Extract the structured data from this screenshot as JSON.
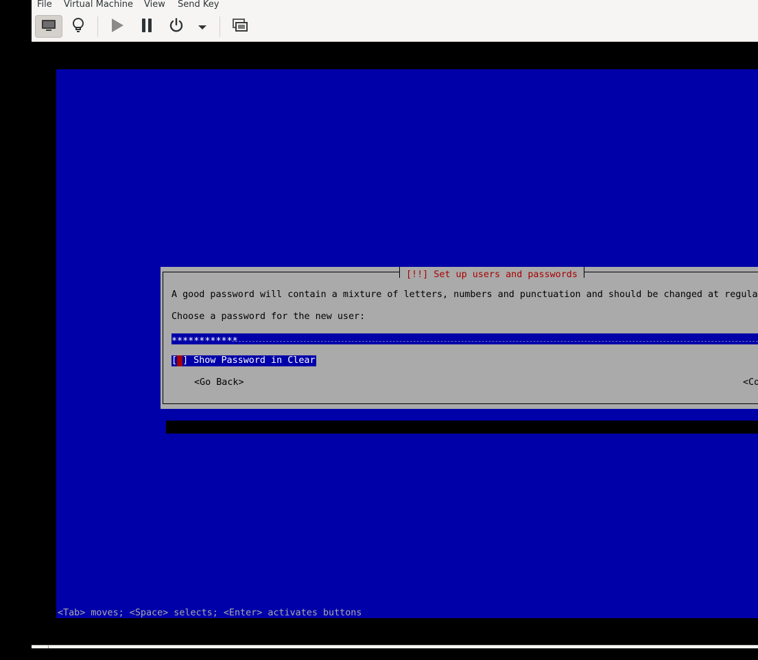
{
  "menubar": {
    "items": [
      "File",
      "Virtual Machine",
      "View",
      "Send Key"
    ]
  },
  "toolbar": {
    "buttons": [
      {
        "icon": "monitor-icon",
        "active": true
      },
      {
        "icon": "lightbulb-icon",
        "active": false
      },
      {
        "icon": "play-icon",
        "active": false
      },
      {
        "icon": "pause-icon",
        "active": false
      },
      {
        "icon": "power-icon",
        "active": false
      },
      {
        "icon": "chevron-down-icon",
        "active": false
      },
      {
        "icon": "screens-icon",
        "active": false
      }
    ]
  },
  "installer": {
    "title": "[!!] Set up users and passwords",
    "description": "A good password will contain a mixture of letters, numbers and punctuation and should be changed at regular",
    "prompt": "Choose a password for the new user:",
    "password_value": "************",
    "show_password_prefix": "[",
    "show_password_suffix": "] Show Password in Clear",
    "go_back_label": "<Go Back>",
    "continue_label": "<Co",
    "help_line": "<Tab> moves; <Space> selects; <Enter> activates buttons"
  },
  "colors": {
    "screen_bg": "#0000a8",
    "dialog_bg": "#aaaaaa",
    "title_color": "#a80000",
    "toolbar_bg": "#f6f5f4"
  }
}
